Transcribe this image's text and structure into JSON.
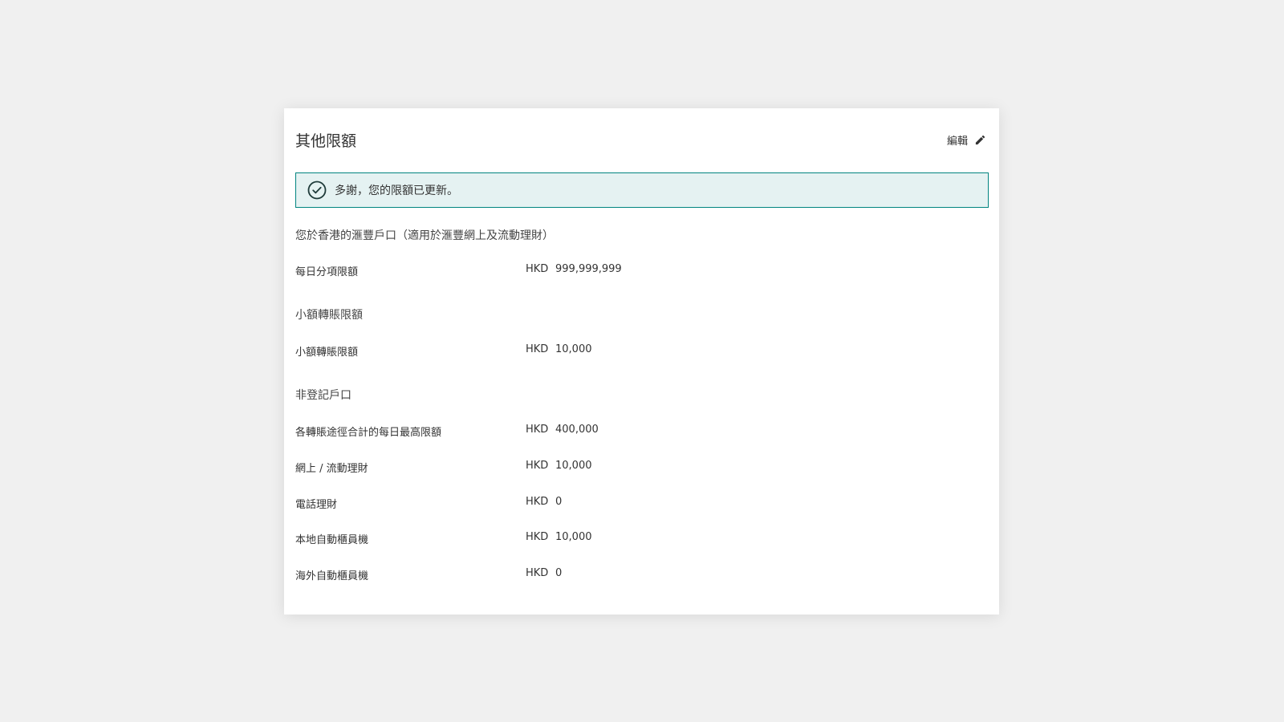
{
  "card": {
    "title": "其他限額",
    "edit_label": "編輯"
  },
  "notice": {
    "icon": "check-circle-icon",
    "text": "多謝，您的限額已更新。",
    "border_color": "#00847f",
    "background_color": "#e5f2f2"
  },
  "sections": [
    {
      "title": "您於香港的滙豐戶口（適用於滙豐網上及流動理財）",
      "rows": [
        {
          "label": "每日分項限額",
          "currency": "HKD",
          "amount": "999,999,999"
        }
      ]
    },
    {
      "title": "小額轉賬限額",
      "rows": [
        {
          "label": "小額轉賬限額",
          "currency": "HKD",
          "amount": "10,000"
        }
      ]
    },
    {
      "title": "非登記戶口",
      "rows": [
        {
          "label": "各轉賬途徑合計的每日最高限額",
          "currency": "HKD",
          "amount": "400,000"
        },
        {
          "label": "網上 / 流動理財",
          "currency": "HKD",
          "amount": "10,000"
        },
        {
          "label": "電話理財",
          "currency": "HKD",
          "amount": "0"
        },
        {
          "label": "本地自動櫃員機",
          "currency": "HKD",
          "amount": "10,000"
        },
        {
          "label": "海外自動櫃員機",
          "currency": "HKD",
          "amount": "0"
        }
      ]
    }
  ]
}
